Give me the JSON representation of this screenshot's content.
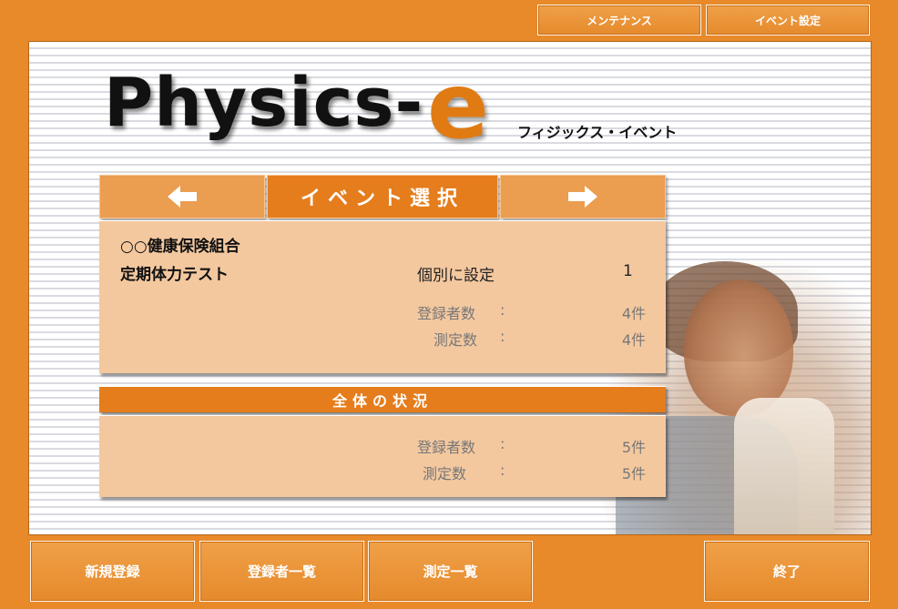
{
  "top_buttons": {
    "maintenance": "メンテナンス",
    "event_settings": "イベント設定"
  },
  "logo": {
    "main": "Physics-",
    "accent": "e",
    "subtitle": "フィジックス・イベント"
  },
  "event_nav": {
    "prev_icon": "arrow-left-icon",
    "title": "イベント選択",
    "next_icon": "arrow-right-icon"
  },
  "event": {
    "organization": "○○健康保険組合",
    "name": "定期体力テスト",
    "mode": "個別に設定",
    "mode_number": "1",
    "registrants_label": "登録者数",
    "registrants_colon": ":",
    "registrants_value": "4件",
    "measurements_label": "測定数",
    "measurements_colon": ":",
    "measurements_value": "4件"
  },
  "overall": {
    "title": "全体の状況",
    "registrants_label": "登録者数",
    "registrants_colon": ":",
    "registrants_value": "5件",
    "measurements_label": "測定数",
    "measurements_colon": ":",
    "measurements_value": "5件"
  },
  "bottom_buttons": {
    "new_registration": "新規登録",
    "registrant_list": "登録者一覧",
    "measurement_list": "測定一覧",
    "exit": "終了"
  },
  "colors": {
    "background": "#e8892a",
    "accent": "#e57d1c",
    "card": "#f4c89f"
  }
}
